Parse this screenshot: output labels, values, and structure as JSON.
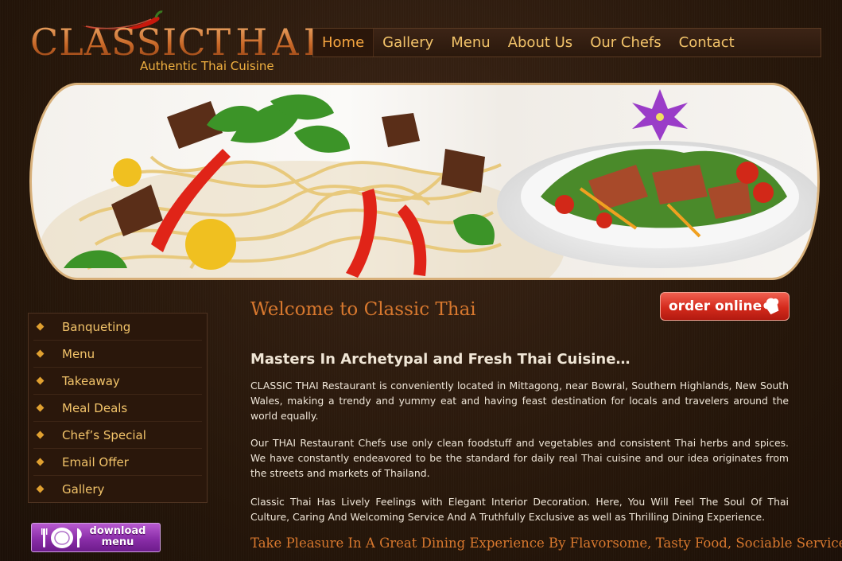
{
  "brand": {
    "name_part1": "CLASSIC",
    "name_part2": "THAI",
    "tagline": "Authentic Thai Cuisine",
    "accent_color": "#f0b040"
  },
  "nav": {
    "items": [
      {
        "label": "Home",
        "active": true
      },
      {
        "label": "Gallery",
        "active": false
      },
      {
        "label": "Menu",
        "active": false
      },
      {
        "label": "About Us",
        "active": false
      },
      {
        "label": "Our Chefs",
        "active": false
      },
      {
        "label": "Contact",
        "active": false
      }
    ]
  },
  "banner": {
    "image_icon": "thai-dishes-photo"
  },
  "sidebar": {
    "items": [
      {
        "label": "Banqueting"
      },
      {
        "label": "Menu"
      },
      {
        "label": "Takeaway"
      },
      {
        "label": "Meal Deals"
      },
      {
        "label": "Chef’s Special"
      },
      {
        "label": "Email Offer"
      },
      {
        "label": "Gallery"
      }
    ],
    "download_line1": "download",
    "download_line2": "menu",
    "download_icon": "plate-cutlery-icon"
  },
  "main": {
    "welcome": "Welcome to Classic Thai",
    "order_label": "order online",
    "order_icon": "chef-hat-icon",
    "subheading": "Masters In Archetypal and Fresh Thai Cuisine…",
    "paragraphs": [
      "CLASSIC THAI Restaurant is conveniently located in Mittagong, near Bowral, Southern Highlands, New South Wales, making a trendy and yummy eat and having feast destination for locals and travelers around the world equally.",
      "Our THAI Restaurant Chefs use only clean foodstuff and vegetables and consistent Thai herbs and spices. We have constantly endeavored to be the standard for daily real Thai cuisine and our idea originates from the streets and markets of Thailand.",
      "Classic Thai Has Lively Feelings with Elegant Interior Decoration. Here, You Will Feel The Soul Of Thai Culture, Caring And Welcoming Service And A Truthfully Exclusive as well as Thrilling Dining Experience."
    ],
    "bottom_tagline": "Take Pleasure In A Great Dining Experience By Flavorsome, Tasty Food, Sociable Service"
  },
  "colors": {
    "background": "#2b1a10",
    "nav_text": "#f3c46a",
    "heading_orange": "#d8782e",
    "order_red": "#d42a1c",
    "download_purple": "#8a2ea8"
  }
}
